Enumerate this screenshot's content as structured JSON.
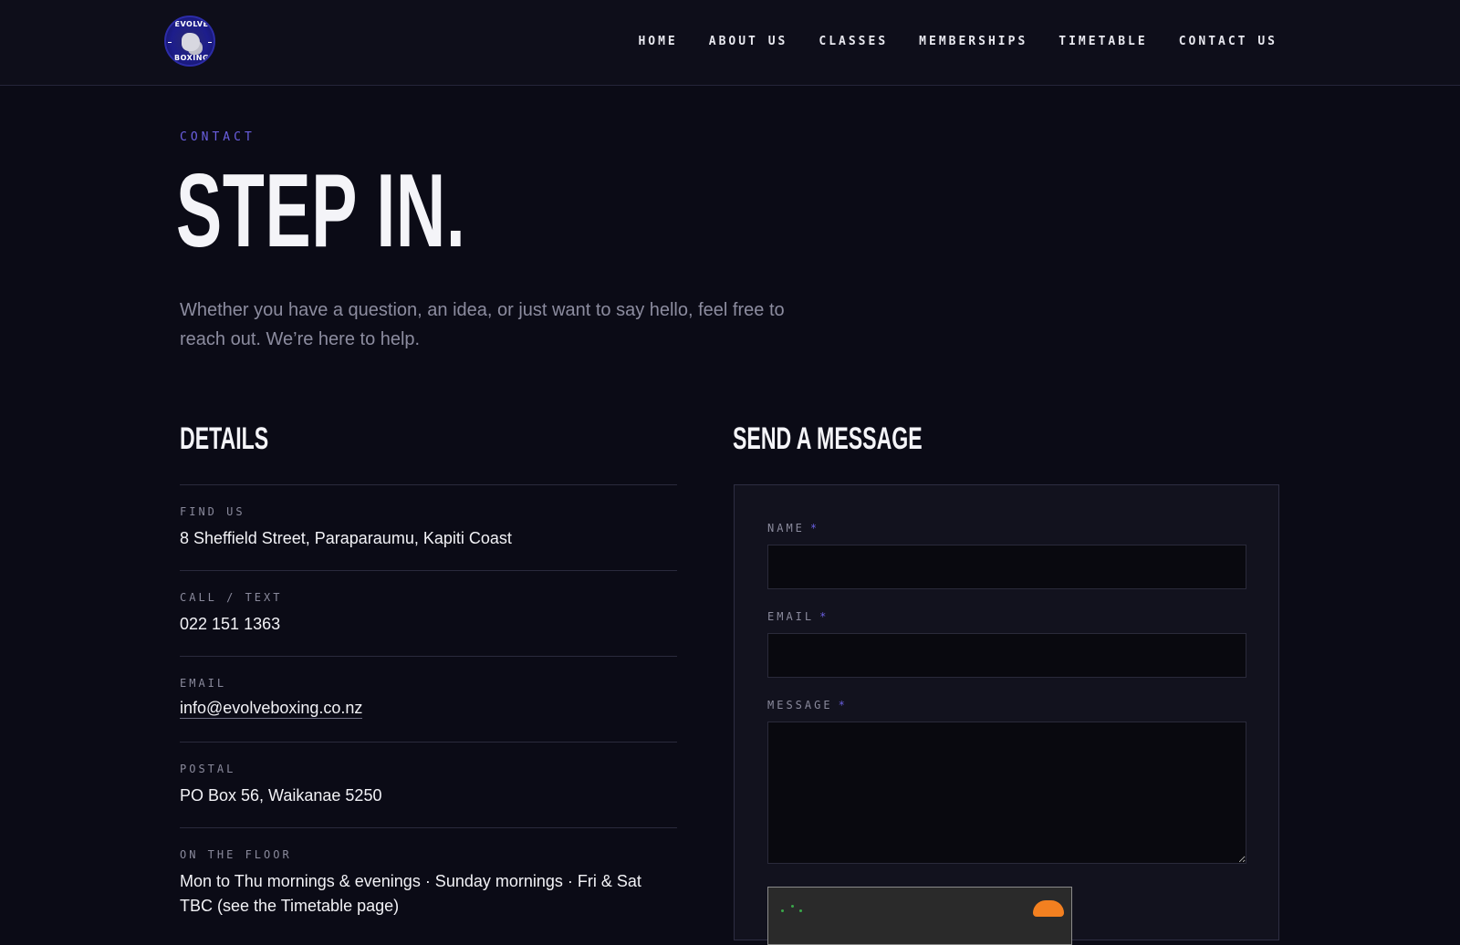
{
  "nav": {
    "logo": {
      "text_top": "EVOLVE",
      "text_bottom": "BOXING"
    },
    "links": [
      "HOME",
      "ABOUT US",
      "CLASSES",
      "MEMBERSHIPS",
      "TIMETABLE",
      "CONTACT US"
    ]
  },
  "hero": {
    "eyebrow": "CONTACT",
    "title": "STEP IN.",
    "lead": "Whether you have a question, an idea, or just want to say hello, feel free to reach out. We’re here to help."
  },
  "details": {
    "heading": "DETAILS",
    "items": [
      {
        "label": "FIND US",
        "value": "8 Sheffield Street, Paraparaumu, Kapiti Coast"
      },
      {
        "label": "CALL / TEXT",
        "value": "022 151 1363"
      },
      {
        "label": "EMAIL",
        "value": "info@evolveboxing.co.nz"
      },
      {
        "label": "POSTAL",
        "value": "PO Box 56, Waikanae 5250"
      },
      {
        "label": "ON THE FLOOR",
        "value": "Mon to Thu mornings & evenings · Sunday mornings · Fri & Sat TBC (see the Timetable page)"
      }
    ]
  },
  "form": {
    "heading": "SEND A MESSAGE",
    "required_mark": "*",
    "name_label": "NAME",
    "name_value": "",
    "email_label": "EMAIL",
    "email_value": "",
    "message_label": "MESSAGE",
    "message_value": ""
  },
  "colors": {
    "background": "#0b0b16",
    "accent": "#6a5fe0",
    "text": "#f2f2f6",
    "muted": "#8c8c9f"
  }
}
